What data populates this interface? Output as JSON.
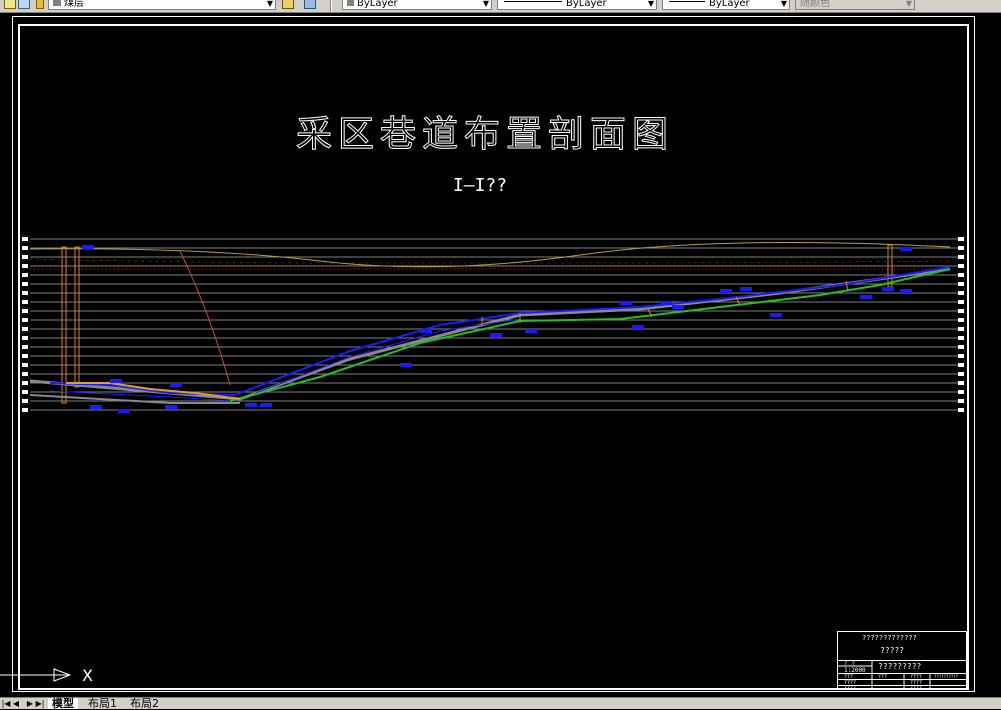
{
  "toolbar": {
    "layer_name": "煤层",
    "color_value": "ByLayer",
    "linetype_value": "ByLayer",
    "lineweight_value": "ByLayer",
    "plotstyle_value": "随颜色"
  },
  "drawing": {
    "title": "采区巷道布置剖面图",
    "subtitle": "I—I??"
  },
  "title_block": {
    "line1": "?????????????",
    "line2": "?????",
    "scale_label": "?  ?",
    "scale_value": "1:2000",
    "drawing_name": "?????????",
    "r1c1": "???",
    "r1c2": "???",
    "r1c3": "????",
    "r1c4": "??????????",
    "r2c1": "????",
    "r2c3": "????",
    "r3c1": "????",
    "r3c3": "????"
  },
  "ucs": {
    "axis_label": "X"
  },
  "tabs": {
    "model": "模型",
    "layout1": "布局1",
    "layout2": "布局2"
  },
  "colors": {
    "background": "#000000",
    "seam_blue": "#1a1aff",
    "roadway_green": "#22c022",
    "surface": "#b8a038",
    "red_layer": "#c04020",
    "gray_layer": "#8a8a8a",
    "orange_shaft": "#e08020"
  }
}
